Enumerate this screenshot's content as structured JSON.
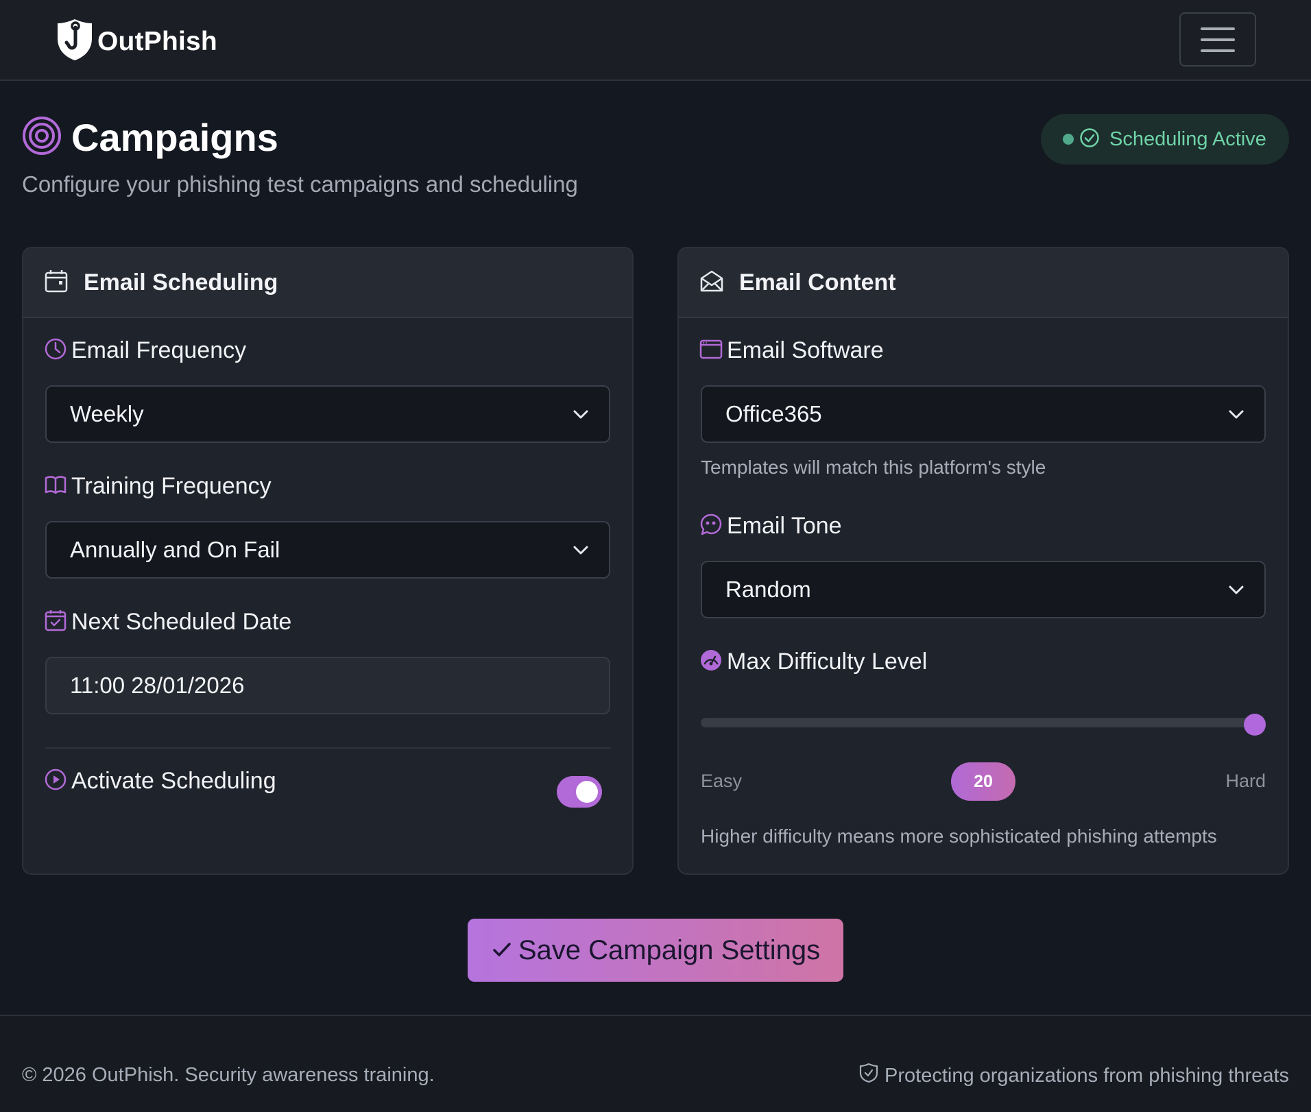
{
  "brand": {
    "name": "OutPhish",
    "icon": "shield-hook-icon"
  },
  "header": {
    "menu_icon": "hamburger-icon"
  },
  "page": {
    "title": "Campaigns",
    "subtitle": "Configure your phishing test campaigns and scheduling",
    "title_icon": "target-icon"
  },
  "status": {
    "label": "Scheduling Active",
    "color": "#6fd3a8",
    "icon": "check-circle-icon"
  },
  "scheduling_card": {
    "title": "Email Scheduling",
    "icon": "calendar-icon",
    "email_frequency": {
      "label": "Email Frequency",
      "value": "Weekly",
      "icon": "clock-icon"
    },
    "training_frequency": {
      "label": "Training Frequency",
      "value": "Annually and On Fail",
      "icon": "book-icon"
    },
    "next_date": {
      "label": "Next Scheduled Date",
      "value": "11:00 28/01/2026",
      "icon": "calendar-check-icon"
    },
    "activate": {
      "label": "Activate Scheduling",
      "enabled": true,
      "icon": "play-circle-icon"
    }
  },
  "content_card": {
    "title": "Email Content",
    "icon": "envelope-open-icon",
    "email_software": {
      "label": "Email Software",
      "value": "Office365",
      "help": "Templates will match this platform's style",
      "icon": "window-icon"
    },
    "email_tone": {
      "label": "Email Tone",
      "value": "Random",
      "icon": "chat-quote-icon"
    },
    "difficulty": {
      "label": "Max Difficulty Level",
      "value": "20",
      "level_fraction": 1.0,
      "min_label": "Easy",
      "max_label": "Hard",
      "help": "Higher difficulty means more sophisticated phishing attempts",
      "icon": "speedometer-icon"
    }
  },
  "actions": {
    "save_label": "Save Campaign Settings",
    "save_icon": "check-icon"
  },
  "footer": {
    "copyright": "© 2026 OutPhish. Security awareness training.",
    "tagline": "Protecting organizations from phishing threats",
    "tagline_icon": "shield-check-icon"
  },
  "colors": {
    "accent": "#b26ad8",
    "background": "#141820",
    "card": "#1f232b"
  }
}
